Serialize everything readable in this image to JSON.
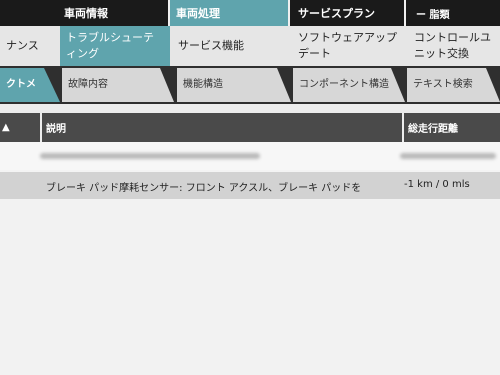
{
  "top_tabs": [
    "車両情報",
    "車両処理",
    "サービスプラン",
    "ー 脂類"
  ],
  "second_tabs": [
    "ナンス",
    "トラブルシューティング",
    "サービス機能",
    "ソフトウェアアップデート",
    "コントロールユニット交換"
  ],
  "third_tabs": [
    "クトメ",
    "故障内容",
    "機能構造",
    "コンポーネント構造",
    "テキスト検索"
  ],
  "table": {
    "sort_icon": "▲",
    "columns": [
      "説明",
      "総走行距離"
    ],
    "rows": [
      {
        "description": "ブレーキ パッド摩耗センサー: フロント アクスル、ブレーキ パッドを",
        "mileage": "-1 km / 0 mls"
      }
    ]
  },
  "colors": {
    "accent": "#5fa4ad",
    "dark": "#1a1a1a",
    "header": "#4a4a4a",
    "row_highlight": "#d2d2d2"
  }
}
